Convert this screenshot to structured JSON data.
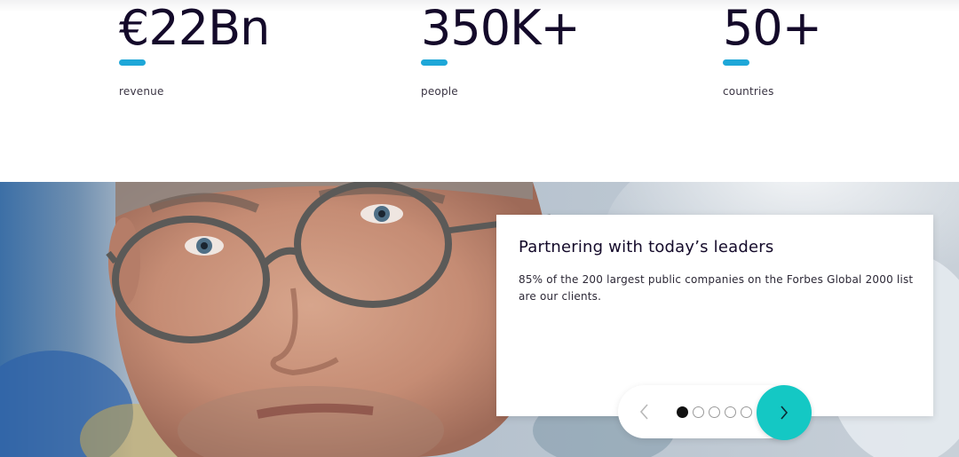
{
  "stats": [
    {
      "value": "€22Bn",
      "label": "revenue"
    },
    {
      "value": "350K+",
      "label": "people"
    },
    {
      "value": "50+",
      "label": "countries"
    }
  ],
  "colors": {
    "accent_bar": "#1ea7d8",
    "next_button": "#14c8c4",
    "heading": "#140a2a"
  },
  "hero": {
    "image_icon": "portrait-man-glasses"
  },
  "card": {
    "title": "Partnering with today’s leaders",
    "text": "85% of the 200 largest public companies on the Forbes Global 2000 list are our clients."
  },
  "carousel": {
    "prev_icon": "chevron-left-icon",
    "next_icon": "chevron-right-icon",
    "slide_count": 5,
    "active_index": 0
  }
}
